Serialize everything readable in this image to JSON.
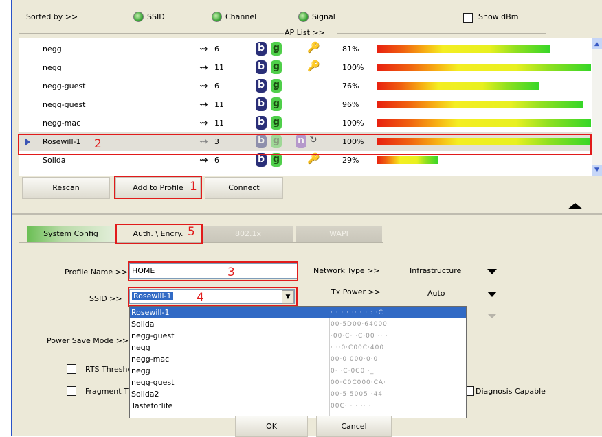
{
  "sort": {
    "label": "Sorted by >>",
    "ssid": "SSID",
    "channel": "Channel",
    "signal": "Signal",
    "show_dbm": "Show dBm",
    "ap_list": "AP List >>"
  },
  "networks": [
    {
      "name": "negg",
      "channel": "6",
      "b": "b",
      "g": "g",
      "n": "",
      "key": "locked",
      "wps": false,
      "signal": "81%",
      "signal_pct": 81
    },
    {
      "name": "negg",
      "channel": "11",
      "b": "b",
      "g": "g",
      "n": "",
      "key": "locked",
      "wps": false,
      "signal": "100%",
      "signal_pct": 100
    },
    {
      "name": "negg-guest",
      "channel": "6",
      "b": "b",
      "g": "g",
      "n": "",
      "key": "none",
      "wps": false,
      "signal": "76%",
      "signal_pct": 76
    },
    {
      "name": "negg-guest",
      "channel": "11",
      "b": "b",
      "g": "g",
      "n": "",
      "key": "none",
      "wps": false,
      "signal": "96%",
      "signal_pct": 96
    },
    {
      "name": "negg-mac",
      "channel": "11",
      "b": "b",
      "g": "g",
      "n": "",
      "key": "none",
      "wps": false,
      "signal": "100%",
      "signal_pct": 100
    },
    {
      "name": "Rosewill-1",
      "channel": "3",
      "b": "b",
      "g": "g",
      "n": "n",
      "key": "none",
      "wps": true,
      "signal": "100%",
      "signal_pct": 100
    },
    {
      "name": "Solida",
      "channel": "6",
      "b": "b",
      "g": "g",
      "n": "",
      "key": "locked",
      "wps": false,
      "signal": "29%",
      "signal_pct": 29
    }
  ],
  "buttons": {
    "rescan": "Rescan",
    "add_to_profile": "Add to Profile",
    "connect": "Connect",
    "ok": "OK",
    "cancel": "Cancel"
  },
  "annotations": {
    "n1": "1",
    "n2": "2",
    "n3": "3",
    "n4": "4",
    "n5": "5"
  },
  "tabs": {
    "system_config": "System Config",
    "auth": "Auth. \\ Encry.",
    "dot1x": "802.1x",
    "wapi": "WAPI"
  },
  "form": {
    "profile_name_label": "Profile Name >>",
    "profile_name_value": "HOME",
    "ssid_label": "SSID >>",
    "ssid_value": "Rosewill-1",
    "network_type_label": "Network Type >>",
    "network_type_value": "Infrastructure",
    "tx_power_label": "Tx Power >>",
    "tx_power_value": "Auto",
    "power_save_label": "Power Save Mode >>",
    "rts_label": "RTS Thresho",
    "fragment_label": "Fragment Th",
    "diagnosis_label": "Diagnosis Capable"
  },
  "dropdown": [
    {
      "name": "Rosewill-1",
      "mac": "· · · · ·· · · : ·C",
      "selected": true
    },
    {
      "name": "Solida",
      "mac": "00·5D00·64000",
      "selected": false
    },
    {
      "name": "negg-guest",
      "mac": "·00·C· ·C·00 ·· ·",
      "selected": false
    },
    {
      "name": "negg",
      "mac": "· ··0·C00C·400",
      "selected": false
    },
    {
      "name": "negg-mac",
      "mac": "00·0·000·0·0",
      "selected": false
    },
    {
      "name": "negg",
      "mac": "0·  ·C·0C0 ·_",
      "selected": false
    },
    {
      "name": "negg-guest",
      "mac": "00·C0C000·CA·",
      "selected": false
    },
    {
      "name": "Solida2",
      "mac": "00·5·5005 ·44",
      "selected": false
    },
    {
      "name": "Tasteforlife",
      "mac": "00C· ·  · ·· ·",
      "selected": false
    }
  ],
  "colors": {
    "highlight": "#e11b1b",
    "selection": "#316ac5",
    "panel": "#ece9d8"
  }
}
